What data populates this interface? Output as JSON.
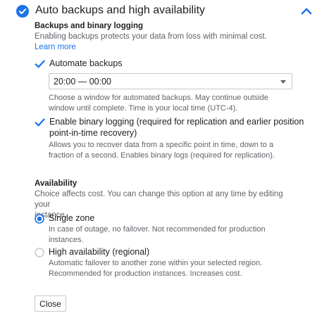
{
  "header": {
    "title": "Auto backups and high availability",
    "status_icon": "check-circle-icon",
    "collapse_icon": "chevron-up-icon"
  },
  "backups": {
    "title": "Backups and binary logging",
    "desc": "Enabling backups protects your data from loss with minimal cost.",
    "learn_more": "Learn more",
    "automate": {
      "label": "Automate backups",
      "checked": true
    },
    "window_select": {
      "value": "20:00 — 00:00"
    },
    "window_help_1": "Choose a window for automated backups. May continue outside",
    "window_help_2": "window until complete. Time is your local time (UTC-4).",
    "binary_logging": {
      "label_1": "Enable binary logging (required for replication and earlier position",
      "label_2": "point-in-time recovery)",
      "checked": true
    },
    "binary_help_1": "Allows you to recover data from a specific point in time, down to a",
    "binary_help_2": "fraction of a second. Enables binary logs (required for replication)."
  },
  "availability": {
    "title": "Availability",
    "desc_1": "Choice affects cost. You can change this option at any time by editing your",
    "desc_2": "instance.",
    "options": [
      {
        "label": "Single zone",
        "selected": true,
        "help_1": "In case of outage, no failover. Not recommended for production",
        "help_2": "instances."
      },
      {
        "label": "High availability (regional)",
        "selected": false,
        "help_1": "Automatic failover to another zone within your selected region.",
        "help_2": "Recommended for production instances. Increases cost."
      }
    ]
  },
  "actions": {
    "close_label": "Close"
  },
  "colors": {
    "accent": "#1a73e8",
    "text": "#202124",
    "secondary_text": "#5f6368"
  }
}
